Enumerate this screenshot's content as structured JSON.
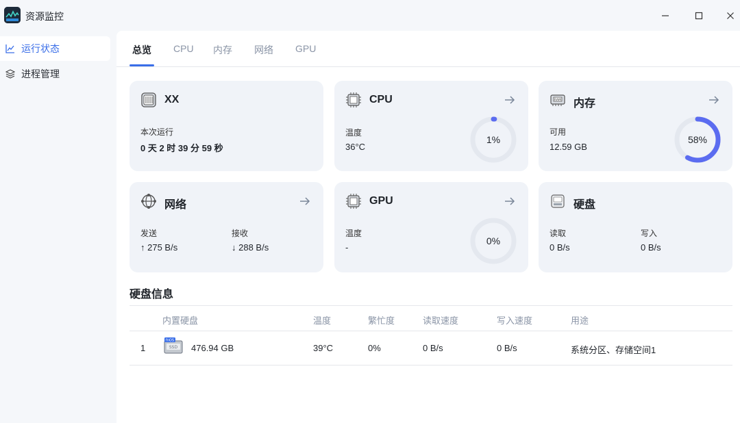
{
  "app": {
    "title": "资源监控"
  },
  "sidebar": {
    "items": [
      {
        "label": "运行状态",
        "icon": "line-chart-icon",
        "active": true
      },
      {
        "label": "进程管理",
        "icon": "layers-icon",
        "active": false
      }
    ]
  },
  "tabs": [
    "总览",
    "CPU",
    "内存",
    "网络",
    "GPU"
  ],
  "cards": {
    "system": {
      "title": "XX",
      "label": "本次运行",
      "value": "0 天 2 时 39 分 59 秒"
    },
    "cpu": {
      "title": "CPU",
      "label": "温度",
      "value": "36°C",
      "usage_text": "1%",
      "usage": 0.01
    },
    "memory": {
      "title": "内存",
      "label": "可用",
      "value": "12.59 GB",
      "usage_text": "58%",
      "usage": 0.58
    },
    "network": {
      "title": "网络",
      "send_label": "发送",
      "send_value": "↑ 275 B/s",
      "recv_label": "接收",
      "recv_value": "↓ 288 B/s"
    },
    "gpu": {
      "title": "GPU",
      "label": "温度",
      "value": "-",
      "usage_text": "0%",
      "usage": 0
    },
    "disk": {
      "title": "硬盘",
      "read_label": "读取",
      "read_value": "0 B/s",
      "write_label": "写入",
      "write_value": "0 B/s"
    }
  },
  "disk_info": {
    "title": "硬盘信息",
    "columns": [
      "内置硬盘",
      "温度",
      "繁忙度",
      "读取速度",
      "写入速度",
      "用途"
    ],
    "rows": [
      {
        "index": "1",
        "badge": "fnOS",
        "size": "476.94 GB",
        "temp": "39°C",
        "busy": "0%",
        "read": "0 B/s",
        "write": "0 B/s",
        "usage": "系统分区、存储空间1"
      }
    ]
  },
  "colors": {
    "accent": "#3a6ee8",
    "ring": "#5b6cf0",
    "ring_track": "#e4e8ef",
    "card_bg": "#f0f3f8"
  }
}
